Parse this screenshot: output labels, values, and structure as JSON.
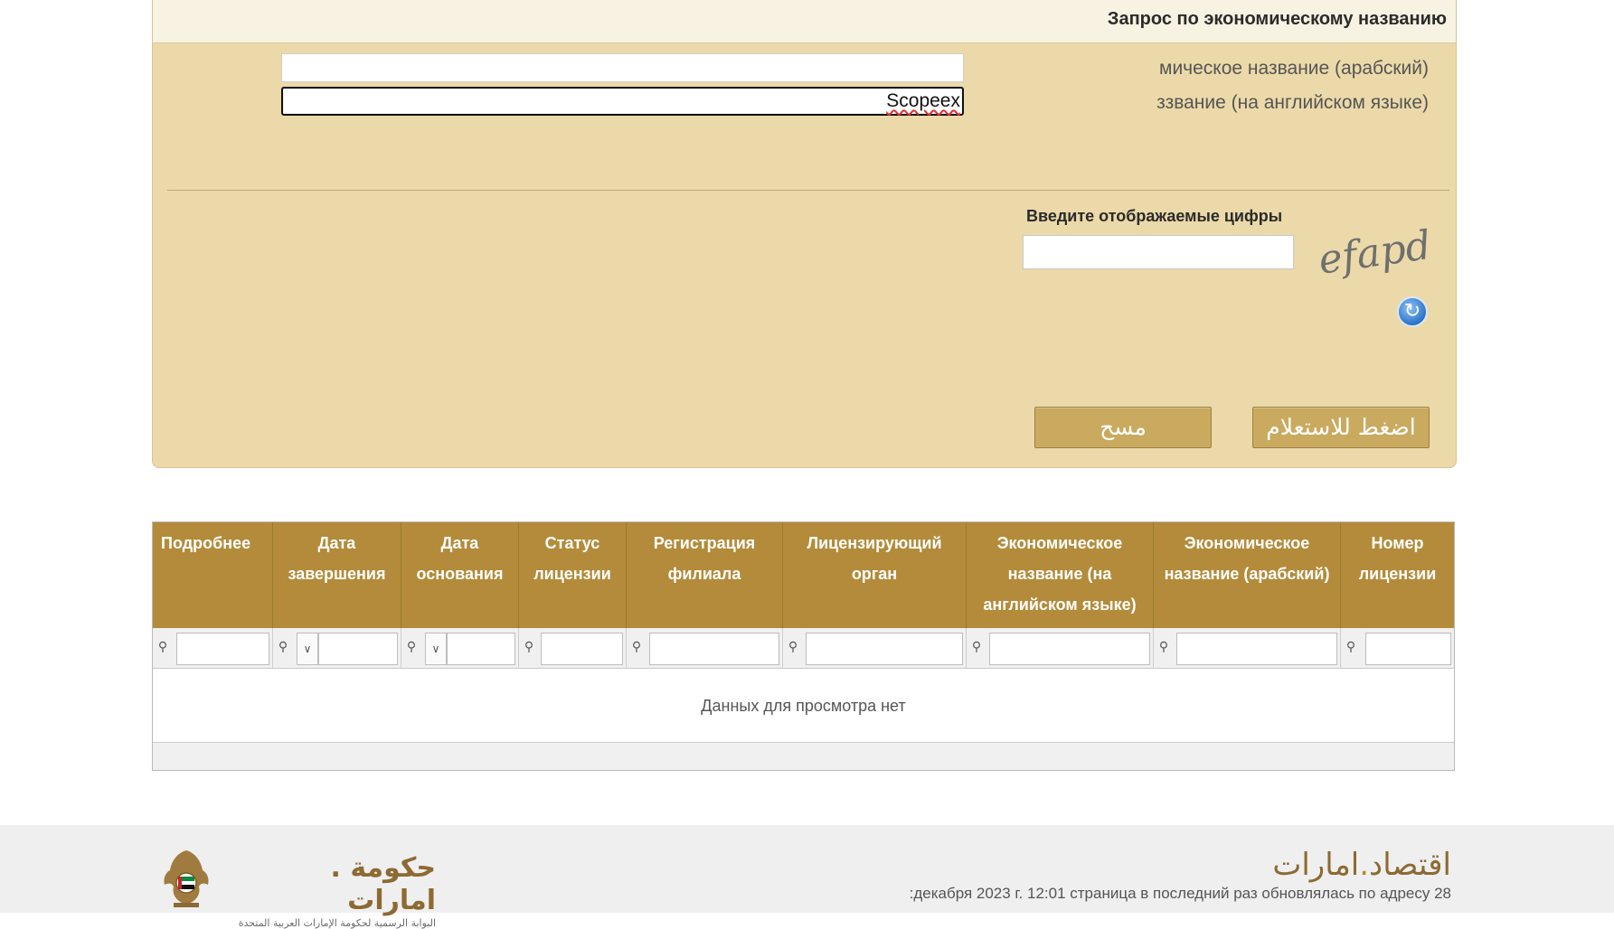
{
  "panel": {
    "title": "Запрос по экономическому названию",
    "label_arabic": "мическое название (арабский)",
    "label_english": "ззвание (на английском языке)",
    "input_arabic_value": "",
    "input_english_value": "Scopeex",
    "captcha_label": "Введите отображаемые цифры",
    "captcha_value": "",
    "captcha_text": "efapd",
    "refresh_icon": "refresh-icon",
    "clear_button": "مسح",
    "search_button": "اضغط للاستعلام",
    "colors": {
      "panel_bg": "#ecd9a9",
      "button_bg": "#c9aa5f",
      "header_bg": "#f8f2e2"
    }
  },
  "grid": {
    "columns": [
      "Подробнее",
      "Дата завершения",
      "Дата основания",
      "Статус лицензии",
      "Регистрация филиала",
      "Лицензирующий орган",
      "Экономическое название (на английском языке)",
      "Экономическое название (арабский)",
      "Номер лицензии"
    ],
    "empty_message": "Данных для просмотра нет",
    "header_color": "#b38b3a"
  },
  "footer": {
    "gov_logo_text": "حكومة . امارات",
    "gov_logo_subtitle": "البوابة الرسمية لحكومة الإمارات العربية المتحدة",
    "eco_logo_left": "اقتصاد",
    "eco_logo_right": "امارات",
    "last_updated": ":декабря 2023 г. 12:01 страница в последний раз обновлялась по адресу 28"
  }
}
